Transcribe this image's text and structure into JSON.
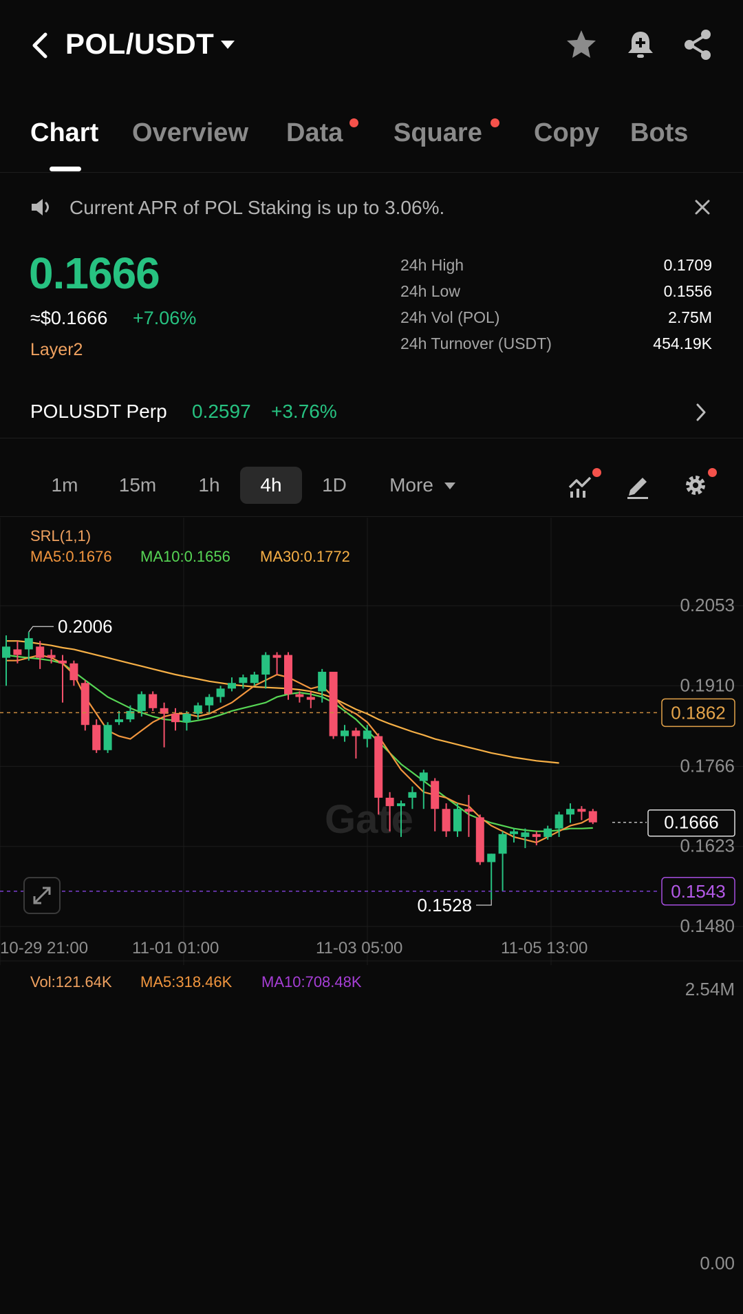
{
  "header": {
    "pair": "POL/USDT"
  },
  "tabs": [
    {
      "label": "Chart",
      "active": true,
      "dot": false
    },
    {
      "label": "Overview",
      "active": false,
      "dot": false
    },
    {
      "label": "Data",
      "active": false,
      "dot": true
    },
    {
      "label": "Square",
      "active": false,
      "dot": true
    },
    {
      "label": "Copy",
      "active": false,
      "dot": false
    },
    {
      "label": "Bots",
      "active": false,
      "dot": false
    }
  ],
  "notice": {
    "text": "Current APR of POL Staking is up to 3.06%."
  },
  "ticker": {
    "last_price": "0.1666",
    "usd_price": "≈$0.1666",
    "change_pct": "+7.06%",
    "tag": "Layer2",
    "stats": [
      {
        "label": "24h High",
        "value": "0.1709"
      },
      {
        "label": "24h Low",
        "value": "0.1556"
      },
      {
        "label": "24h Vol (POL)",
        "value": "2.75M"
      },
      {
        "label": "24h Turnover (USDT)",
        "value": "454.19K"
      }
    ]
  },
  "perp": {
    "name": "POLUSDT Perp",
    "price": "0.2597",
    "change_pct": "+3.76%"
  },
  "intervals": {
    "items": [
      "1m",
      "15m",
      "1h",
      "4h",
      "1D"
    ],
    "active": "4h",
    "more_label": "More"
  },
  "indicators": {
    "srl": "SRL(1,1)",
    "ma5": "MA5:0.1676",
    "ma10": "MA10:0.1656",
    "ma30": "MA30:0.1772",
    "vol": "Vol:121.64K",
    "vol_ma5": "MA5:318.46K",
    "vol_ma10": "MA10:708.48K"
  },
  "colors": {
    "up": "#27c281",
    "down": "#f5516b",
    "ma5": "#f2963e",
    "ma10": "#57d655",
    "ma30": "#f7b046",
    "accent_orange": "#f0a260",
    "purple": "#a63ed6"
  },
  "watermark": "Gate",
  "chart_data": {
    "type": "candlestick",
    "interval": "4h",
    "price_axis": {
      "min": 0.148,
      "max": 0.2053,
      "ticks": [
        "0.2053",
        "0.1910",
        "0.1766",
        "0.1623",
        "0.1480"
      ]
    },
    "time_axis": {
      "ticks": [
        "10-29 21:00",
        "11-01 01:00",
        "11-03 05:00",
        "11-05 13:00"
      ]
    },
    "markers": {
      "high_label": "0.2006",
      "low_label": "0.1528",
      "last_price_tag": "0.1666",
      "level_orange": "0.1862",
      "level_purple": "0.1543"
    },
    "candles": [
      [
        0.196,
        0.198,
        0.191,
        0.2
      ],
      [
        0.1975,
        0.1965,
        0.195,
        0.199
      ],
      [
        0.1975,
        0.1995,
        0.1955,
        0.2006
      ],
      [
        0.198,
        0.196,
        0.194,
        0.199
      ],
      [
        0.1965,
        0.196,
        0.195,
        0.1975
      ],
      [
        0.1955,
        0.195,
        0.188,
        0.1965
      ],
      [
        0.195,
        0.192,
        0.191,
        0.1955
      ],
      [
        0.1915,
        0.184,
        0.183,
        0.192
      ],
      [
        0.184,
        0.1795,
        0.179,
        0.185
      ],
      [
        0.1795,
        0.184,
        0.179,
        0.1845
      ],
      [
        0.1845,
        0.185,
        0.184,
        0.1865
      ],
      [
        0.185,
        0.1865,
        0.1845,
        0.1875
      ],
      [
        0.1865,
        0.1895,
        0.1855,
        0.19
      ],
      [
        0.1895,
        0.187,
        0.1865,
        0.19
      ],
      [
        0.187,
        0.186,
        0.18,
        0.188
      ],
      [
        0.186,
        0.1845,
        0.183,
        0.187
      ],
      [
        0.1845,
        0.186,
        0.183,
        0.1865
      ],
      [
        0.186,
        0.1875,
        0.185,
        0.188
      ],
      [
        0.1875,
        0.189,
        0.186,
        0.1895
      ],
      [
        0.189,
        0.1905,
        0.188,
        0.191
      ],
      [
        0.1905,
        0.1915,
        0.19,
        0.1925
      ],
      [
        0.1915,
        0.1925,
        0.1905,
        0.193
      ],
      [
        0.1915,
        0.193,
        0.191,
        0.1935
      ],
      [
        0.193,
        0.1965,
        0.1905,
        0.197
      ],
      [
        0.1965,
        0.196,
        0.193,
        0.197
      ],
      [
        0.1965,
        0.1895,
        0.1885,
        0.197
      ],
      [
        0.1895,
        0.189,
        0.188,
        0.19
      ],
      [
        0.189,
        0.1885,
        0.187,
        0.19
      ],
      [
        0.19,
        0.1935,
        0.188,
        0.194
      ],
      [
        0.1935,
        0.182,
        0.1815,
        0.1935
      ],
      [
        0.182,
        0.183,
        0.181,
        0.184
      ],
      [
        0.183,
        0.182,
        0.178,
        0.1835
      ],
      [
        0.1815,
        0.183,
        0.18,
        0.184
      ],
      [
        0.182,
        0.171,
        0.168,
        0.1825
      ],
      [
        0.171,
        0.1695,
        0.165,
        0.172
      ],
      [
        0.1695,
        0.17,
        0.164,
        0.1705
      ],
      [
        0.171,
        0.172,
        0.169,
        0.173
      ],
      [
        0.174,
        0.1755,
        0.169,
        0.176
      ],
      [
        0.174,
        0.169,
        0.165,
        0.1745
      ],
      [
        0.169,
        0.165,
        0.164,
        0.17
      ],
      [
        0.165,
        0.169,
        0.164,
        0.17
      ],
      [
        0.169,
        0.1685,
        0.164,
        0.1715
      ],
      [
        0.1675,
        0.1595,
        0.159,
        0.168
      ],
      [
        0.1595,
        0.161,
        0.1528,
        0.161
      ],
      [
        0.161,
        0.1645,
        0.1543,
        0.165
      ],
      [
        0.1645,
        0.165,
        0.163,
        0.1655
      ],
      [
        0.164,
        0.1648,
        0.162,
        0.1655
      ],
      [
        0.1645,
        0.164,
        0.1625,
        0.165
      ],
      [
        0.164,
        0.1655,
        0.1635,
        0.166
      ],
      [
        0.1655,
        0.168,
        0.164,
        0.1685
      ],
      [
        0.168,
        0.169,
        0.1665,
        0.17
      ],
      [
        0.169,
        0.1685,
        0.167,
        0.1695
      ],
      [
        0.1686,
        0.1666,
        0.1663,
        0.169
      ]
    ],
    "ma5": [
      0.1955,
      0.1955,
      0.196,
      0.1965,
      0.196,
      0.195,
      0.193,
      0.189,
      0.186,
      0.183,
      0.182,
      0.1815,
      0.183,
      0.1845,
      0.1855,
      0.186,
      0.186,
      0.1855,
      0.186,
      0.187,
      0.188,
      0.1895,
      0.191,
      0.192,
      0.193,
      0.1925,
      0.1915,
      0.1905,
      0.191,
      0.189,
      0.187,
      0.186,
      0.1845,
      0.182,
      0.179,
      0.176,
      0.174,
      0.172,
      0.1715,
      0.171,
      0.17,
      0.1695,
      0.1675,
      0.166,
      0.165,
      0.164,
      0.1635,
      0.163,
      0.164,
      0.165,
      0.166,
      0.1665,
      0.1676
    ],
    "ma10": [
      0.1965,
      0.1962,
      0.196,
      0.1958,
      0.1955,
      0.195,
      0.1935,
      0.192,
      0.1905,
      0.189,
      0.188,
      0.187,
      0.1862,
      0.1855,
      0.185,
      0.1848,
      0.1845,
      0.1848,
      0.1852,
      0.1858,
      0.1865,
      0.187,
      0.1875,
      0.188,
      0.189,
      0.1895,
      0.1898,
      0.1895,
      0.189,
      0.188,
      0.1865,
      0.185,
      0.183,
      0.181,
      0.179,
      0.177,
      0.1755,
      0.174,
      0.1725,
      0.171,
      0.1695,
      0.168,
      0.1672,
      0.1665,
      0.166,
      0.1655,
      0.1652,
      0.165,
      0.165,
      0.1652,
      0.1655,
      0.1655,
      0.1656
    ],
    "ma30": [
      0.199,
      0.199,
      0.1988,
      0.1985,
      0.1982,
      0.1978,
      0.1975,
      0.197,
      0.1965,
      0.196,
      0.1955,
      0.195,
      0.1945,
      0.194,
      0.1935,
      0.193,
      0.1926,
      0.1922,
      0.1918,
      0.1915,
      0.1912,
      0.191,
      0.1908,
      0.1907,
      0.1906,
      0.1905,
      0.1903,
      0.19,
      0.1895,
      0.1888,
      0.1878,
      0.1868,
      0.186,
      0.185,
      0.1842,
      0.1835,
      0.1828,
      0.1822,
      0.1815,
      0.181,
      0.1805,
      0.18,
      0.1795,
      0.179,
      0.1786,
      0.1782,
      0.1779,
      0.1776,
      0.1774,
      0.1772
    ]
  }
}
